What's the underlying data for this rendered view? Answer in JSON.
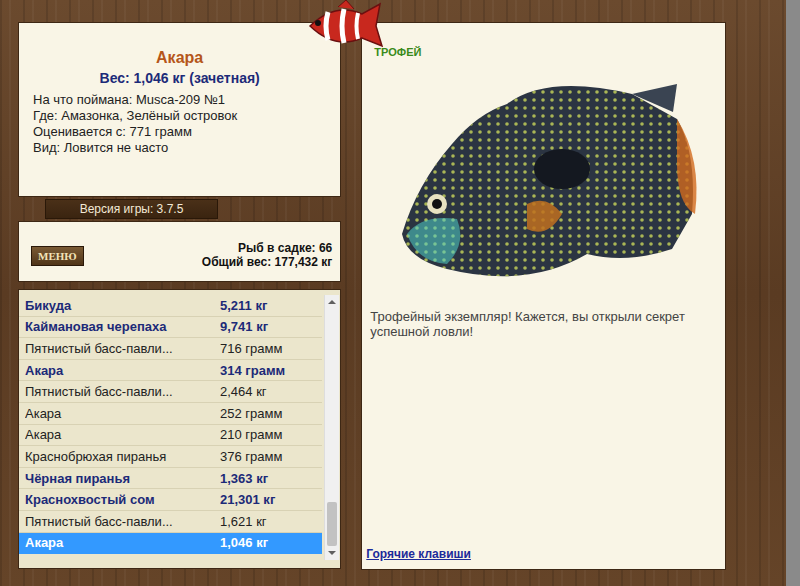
{
  "trophy_badge": "ТРОФЕЙ",
  "catch": {
    "name": "Акара",
    "weight": "Вес: 1,046 кг (зачетная)",
    "details": [
      "На что поймана: Musca-209 №1",
      "Где: Амазонка, Зелёный островок",
      "Оценивается с: 771 грамм",
      "Вид: Ловится не часто"
    ]
  },
  "version": "Версия игры: 3.7.5",
  "menu_button": "МЕНЮ",
  "keep_net": {
    "count": "Рыб в садке: 66",
    "total": "Общий вес: 177,432 кг"
  },
  "catch_list": [
    {
      "name": "Бикуда",
      "weight": "5,211 кг",
      "counted": true,
      "selected": false
    },
    {
      "name": "Каймановая черепаха",
      "weight": "9,741 кг",
      "counted": true,
      "selected": false
    },
    {
      "name": "Пятнистый басс-павли...",
      "weight": "716 грамм",
      "counted": false,
      "selected": false
    },
    {
      "name": "Акара",
      "weight": "314 грамм",
      "counted": true,
      "selected": false
    },
    {
      "name": "Пятнистый басс-павли...",
      "weight": "2,464 кг",
      "counted": false,
      "selected": false
    },
    {
      "name": "Акара",
      "weight": "252 грамм",
      "counted": false,
      "selected": false
    },
    {
      "name": "Акара",
      "weight": "210 грамм",
      "counted": false,
      "selected": false
    },
    {
      "name": "Краснобрюхая пиранья",
      "weight": "376 грамм",
      "counted": false,
      "selected": false
    },
    {
      "name": "Чёрная пиранья",
      "weight": "1,363 кг",
      "counted": true,
      "selected": false
    },
    {
      "name": "Краснохвостый сом",
      "weight": "21,301 кг",
      "counted": true,
      "selected": false
    },
    {
      "name": "Пятнистый басс-павли...",
      "weight": "1,621 кг",
      "counted": false,
      "selected": false
    },
    {
      "name": "Акара",
      "weight": "1,046 кг",
      "counted": true,
      "selected": true
    }
  ],
  "list_scroll": {
    "level": 1
  },
  "message": "Трофейный экземпляр! Кажется, вы открыли секрет успешной ловли!",
  "hotkeys_link": "Горячие клавиши"
}
